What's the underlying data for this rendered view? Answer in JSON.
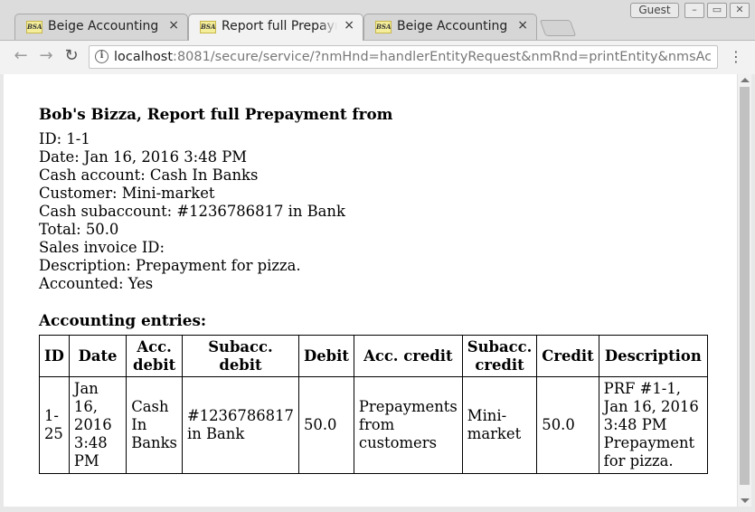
{
  "browser": {
    "guest_label": "Guest",
    "tabs": [
      {
        "favicon": "BSA",
        "title": "Beige Accounting",
        "active": false
      },
      {
        "favicon": "BSA",
        "title": "Report full Prepayment from",
        "active": true
      },
      {
        "favicon": "BSA",
        "title": "Beige Accounting",
        "active": false
      }
    ],
    "close_glyph": "×",
    "url_host": "localhost",
    "url_rest": ":8081/secure/service/?nmHnd=handlerEntityRequest&nmRnd=printEntity&nmsAc..."
  },
  "report": {
    "title": "Bob's Bizza, Report full Prepayment from",
    "fields": [
      "ID: 1-1",
      "Date: Jan 16, 2016 3:48 PM",
      "Cash account: Cash In Banks",
      "Customer: Mini-market",
      "Cash subaccount: #1236786817 in Bank",
      "Total: 50.0",
      "Sales invoice ID:",
      "Description: Prepayment for pizza.",
      "Accounted: Yes"
    ],
    "entries_heading": "Accounting entries:",
    "columns": [
      "ID",
      "Date",
      "Acc. debit",
      "Subacc. debit",
      "Debit",
      "Acc. credit",
      "Subacc. credit",
      "Credit",
      "Description"
    ],
    "rows": [
      [
        "1-25",
        "Jan 16, 2016 3:48 PM",
        "Cash In Banks",
        "#1236786817 in Bank",
        "50.0",
        "Prepayments from customers",
        "Mini-market",
        "50.0",
        "PRF #1-1, Jan 16, 2016 3:48 PM Prepayment for pizza."
      ]
    ]
  }
}
